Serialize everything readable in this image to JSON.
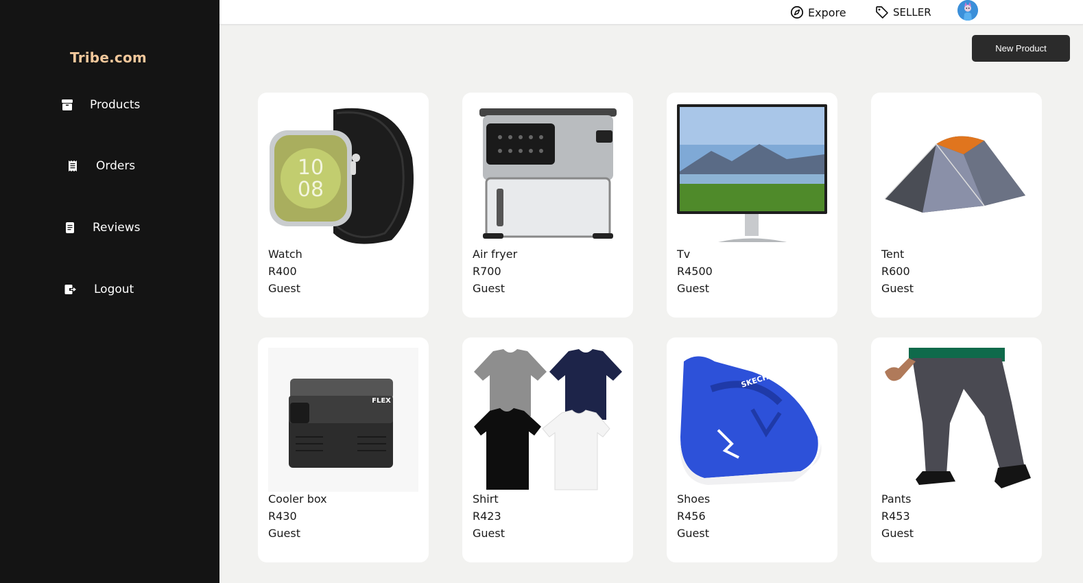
{
  "sidebar": {
    "brand": "Tribe.com",
    "items": [
      {
        "label": "Products",
        "icon": "box-icon"
      },
      {
        "label": "Orders",
        "icon": "receipt-icon"
      },
      {
        "label": "Reviews",
        "icon": "document-icon"
      },
      {
        "label": "Logout",
        "icon": "logout-icon"
      }
    ]
  },
  "header": {
    "explore_label": "Expore",
    "seller_label": "SELLER"
  },
  "actions": {
    "new_product_label": "New Product"
  },
  "products": [
    {
      "name": "Watch",
      "price": "R400",
      "seller": "Guest",
      "icon": "watch-image"
    },
    {
      "name": "Air fryer",
      "price": "R700",
      "seller": "Guest",
      "icon": "air-fryer-image"
    },
    {
      "name": "Tv",
      "price": "R4500",
      "seller": "Guest",
      "icon": "tv-image"
    },
    {
      "name": "Tent",
      "price": "R600",
      "seller": "Guest",
      "icon": "tent-image"
    },
    {
      "name": "Cooler box",
      "price": "R430",
      "seller": "Guest",
      "icon": "cooler-box-image"
    },
    {
      "name": "Shirt",
      "price": "R423",
      "seller": "Guest",
      "icon": "shirt-image"
    },
    {
      "name": "Shoes",
      "price": "R456",
      "seller": "Guest",
      "icon": "shoes-image"
    },
    {
      "name": "Pants",
      "price": "R453",
      "seller": "Guest",
      "icon": "pants-image"
    }
  ],
  "colors": {
    "sidebar_bg": "#141414",
    "brand": "#f1c79b",
    "page_bg": "#f2f2f0",
    "button_bg": "#2b2b2b"
  }
}
